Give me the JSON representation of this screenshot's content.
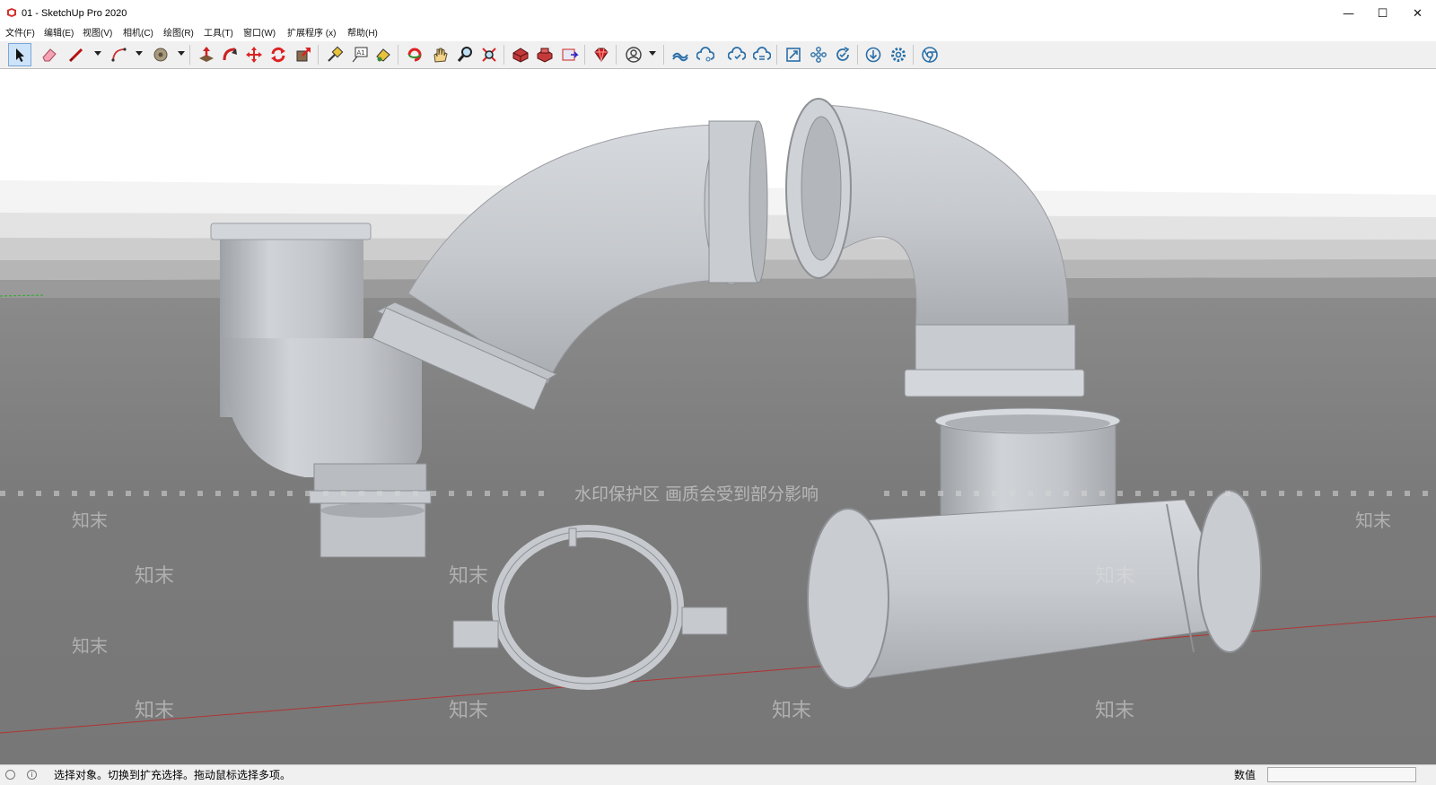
{
  "window": {
    "title": "01 - SketchUp Pro 2020",
    "icon": "sketchup-logo-icon",
    "controls": {
      "minimize": "—",
      "maximize": "☐",
      "close": "✕"
    }
  },
  "menu": [
    {
      "id": "file",
      "label": "文件(F)"
    },
    {
      "id": "edit",
      "label": "编辑(E)"
    },
    {
      "id": "view",
      "label": "视图(V)"
    },
    {
      "id": "camera",
      "label": "相机(C)"
    },
    {
      "id": "draw",
      "label": "绘图(R)"
    },
    {
      "id": "tools",
      "label": "工具(T)"
    },
    {
      "id": "window",
      "label": "窗口(W)"
    },
    {
      "id": "extensions",
      "label": "扩展程序 (x)"
    },
    {
      "id": "help",
      "label": "帮助(H)"
    }
  ],
  "toolbar": {
    "tools": [
      "select-tool-icon",
      "eraser-tool-icon",
      "line-tool-icon",
      "arc-tool-icon",
      "paint-bucket-icon",
      "push-pull-icon",
      "follow-me-icon",
      "move-tool-icon",
      "rotate-tool-icon",
      "scale-tool-icon",
      "tape-measure-icon",
      "text-tool-icon",
      "paint-tool-icon",
      "orbit-icon",
      "pan-icon",
      "zoom-icon",
      "zoom-extents-icon",
      "3d-warehouse-icon",
      "extension-warehouse-icon",
      "layout-icon",
      "extension-manager-icon",
      "account-icon",
      "trimble-connect-icon",
      "cloud-share-icon",
      "cloud-sync-icon",
      "cloud-upload-icon",
      "model-info-icon",
      "components-icon",
      "refresh-icon",
      "download-icon",
      "settings-icon",
      "chrome-icon"
    ],
    "text_tool_glyph": "A1"
  },
  "viewport": {
    "watermark_banner": "水印保护区   画质会受到部分影响",
    "watermark_mark": "知末",
    "colors": {
      "sky": "#ffffff",
      "ground": "#7d7d7d",
      "pipe": "#c6c9cd",
      "axis_red": "#b23434",
      "axis_green": "#38a838"
    }
  },
  "status": {
    "message": "选择对象。切换到扩充选择。拖动鼠标选择多项。",
    "measurements_label": "数值",
    "measurements_value": "",
    "icon_left": "geo-location-icon",
    "icon_info": "info-icon",
    "info_glyph": "i"
  }
}
